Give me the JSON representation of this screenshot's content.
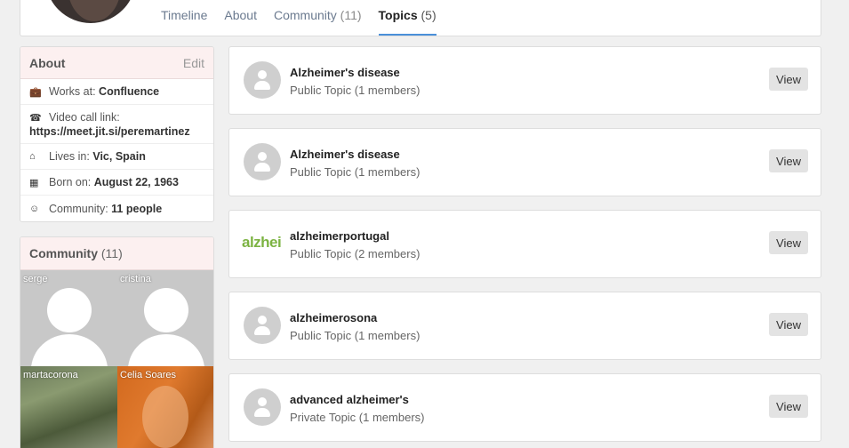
{
  "header": {
    "tabs": [
      {
        "label": "Timeline",
        "count": ""
      },
      {
        "label": "About",
        "count": ""
      },
      {
        "label": "Community",
        "count": "(11)"
      },
      {
        "label": "Topics",
        "count": "(5)"
      }
    ],
    "active_tab": "Topics"
  },
  "about": {
    "title": "About",
    "edit_label": "Edit",
    "works_label": "Works at:",
    "works_value": "Confluence",
    "video_label": "Video call link:",
    "video_value": "https://meet.jit.si/peremartinez",
    "lives_label": "Lives in:",
    "lives_value": "Vic, Spain",
    "born_label": "Born on:",
    "born_value": "August 22, 1963",
    "community_label": "Community:",
    "community_value": "11 people"
  },
  "community": {
    "title": "Community",
    "count": "(11)",
    "members": [
      "serge",
      "cristina",
      "martacorona",
      "Celia Soares"
    ]
  },
  "topics": [
    {
      "title": "Alzheimer's disease",
      "subtitle": "Public Topic (1 members)",
      "button": "View",
      "avatar": "default-avatar"
    },
    {
      "title": "Alzheimer's disease",
      "subtitle": "Public Topic (1 members)",
      "button": "View",
      "avatar": "default-avatar"
    },
    {
      "title": "alzheimerportugal",
      "subtitle": "Public Topic (2 members)",
      "button": "View",
      "avatar": "logo",
      "logo_text": "alzhei"
    },
    {
      "title": "alzheimerosona",
      "subtitle": "Public Topic (1 members)",
      "button": "View",
      "avatar": "default-avatar"
    },
    {
      "title": "advanced alzheimer's",
      "subtitle": "Private Topic (1 members)",
      "button": "View",
      "avatar": "default-avatar"
    }
  ],
  "colors": {
    "accent": "#4a90d9",
    "card_head_bg": "#fcf0f0",
    "logo_green": "#7cb342"
  }
}
